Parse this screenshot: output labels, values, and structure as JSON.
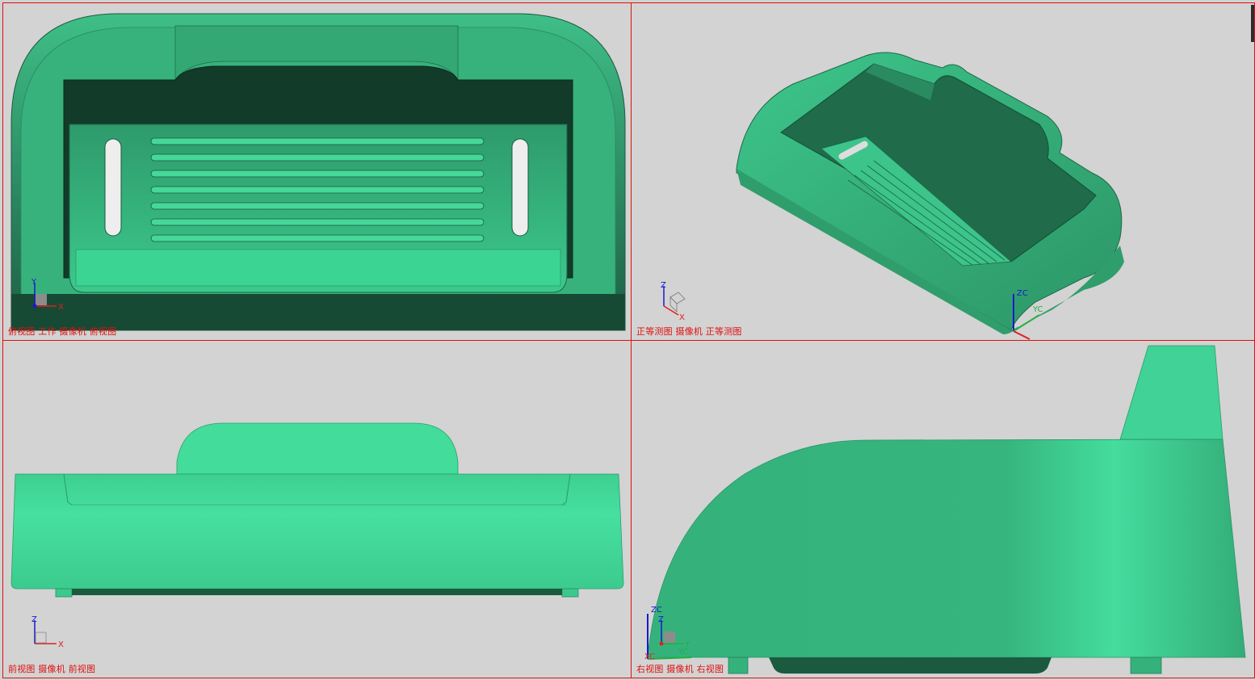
{
  "viewports": {
    "top": {
      "label": "俯视图 工作 摄像机 俯视图",
      "triad_axes": [
        "Y",
        "X"
      ]
    },
    "iso": {
      "label": "正等测图 摄像机 正等测图",
      "triad_axes": [
        "Z",
        "X"
      ],
      "csys_axes": [
        "ZC",
        "YC"
      ]
    },
    "front": {
      "label": "前视图 摄像机 前视图",
      "triad_axes": [
        "Z",
        "X"
      ]
    },
    "right": {
      "label": "右视图 摄像机 右视图",
      "triad_axes": [
        "Z",
        "Y"
      ],
      "csys_axes": [
        "ZC",
        "YC",
        "XC"
      ]
    }
  },
  "colors": {
    "border": "#e01010",
    "background": "#d3d3d3",
    "model_light": "#46e0a0",
    "model_mid": "#36b57e",
    "model_dark": "#123b2a"
  }
}
